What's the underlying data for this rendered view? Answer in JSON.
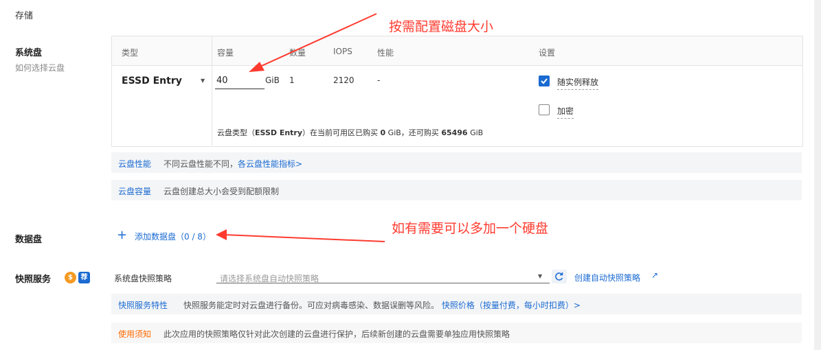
{
  "section": {
    "title": "存储"
  },
  "system_disk": {
    "label": "系统盘",
    "help_link": "如何选择云盘",
    "columns": [
      "类型",
      "容量",
      "数量",
      "IOPS",
      "性能",
      "设置"
    ],
    "type_value": "ESSD Entry",
    "capacity_value": "40",
    "capacity_unit": "GiB",
    "quantity": "1",
    "iops": "2120",
    "performance": "-",
    "release_with_instance": {
      "label": "随实例释放",
      "checked": true
    },
    "encrypt": {
      "label": "加密",
      "checked": false
    },
    "quota_text": {
      "pre": "云盘类型（",
      "type": "ESSD Entry",
      "mid1": "）在当前可用区已购买 ",
      "bought": "0",
      "mid2": " GiB，还可购买 ",
      "remaining": "65496",
      "post": " GiB"
    }
  },
  "info_performance": {
    "key": "云盘性能",
    "text": "不同云盘性能不同，",
    "link": "各云盘性能指标>"
  },
  "info_capacity": {
    "key": "云盘容量",
    "text": "云盘创建总大小会受到配额限制"
  },
  "data_disk": {
    "label": "数据盘",
    "add_button": "添加数据盘（0 / 8）"
  },
  "snapshot": {
    "label": "快照服务",
    "badge_paid": "$",
    "badge_recommend": "荐",
    "policy_label": "系统盘快照策略",
    "policy_placeholder": "请选择系统盘自动快照策略",
    "create_link": "创建自动快照策略",
    "feature_key": "快照服务特性",
    "feature_text": "快照服务能定时对云盘进行备份。可应对病毒感染、数据误删等风险。",
    "feature_link": "快照价格（按量付费，每小时扣费）>",
    "notice_key": "使用须知",
    "notice_text": "此次应用的快照策略仅针对此次创建的云盘进行保护，后续新创建的云盘需要单独应用快照策略"
  },
  "annotations": {
    "top": "按需配置磁盘大小",
    "middle": "如有需要可以多加一个硬盘"
  },
  "colors": {
    "accent": "#1a6ad1",
    "annotation": "#ff3b2f",
    "paid_badge": "#f59a23",
    "notice": "#ff6a00"
  }
}
